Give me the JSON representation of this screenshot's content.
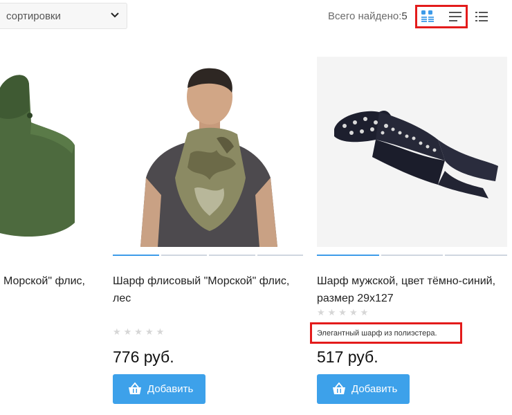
{
  "toolbar": {
    "sort_placeholder": "сортировки",
    "total_label": "Всего найдено:",
    "total_count": "5",
    "view_modes": [
      {
        "icon": "grid-view-icon",
        "active": true
      },
      {
        "icon": "list-view-icon",
        "active": false
      },
      {
        "icon": "compact-list-view-icon",
        "active": false
      }
    ]
  },
  "products": [
    {
      "title": "Морской\" флис,",
      "image_icon": "green-fleece-scarf-image"
    },
    {
      "title": "Шарф флисовый \"Морской\" флис, лес",
      "rating": "★★★★★",
      "price": "776 руб.",
      "add_label": "Добавить",
      "image_icon": "camo-fleece-scarf-on-man-image"
    },
    {
      "title": "Шарф мужской, цвет тёмно-синий, размер 29х127",
      "rating": "★★★★★",
      "description": "Элегантный шарф из полиэстера.",
      "price": "517 руб.",
      "add_label": "Добавить",
      "image_icon": "navy-scarf-image"
    }
  ],
  "colors": {
    "accent": "#3da1ea",
    "highlight": "#e31b1b",
    "icon_active": "#3d9be9"
  }
}
